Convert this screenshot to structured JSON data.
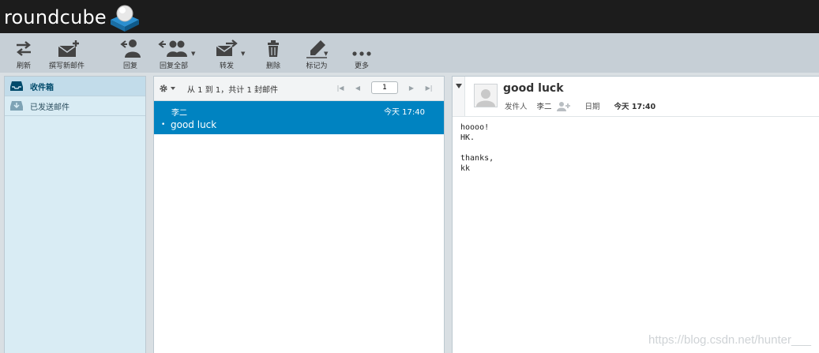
{
  "app": {
    "logo_text": "roundcube"
  },
  "toolbar": {
    "refresh": "刷新",
    "compose": "撰写新邮件",
    "reply": "回复",
    "reply_all": "回复全部",
    "forward": "转发",
    "delete": "删除",
    "mark": "标记为",
    "more": "更多"
  },
  "folders": [
    {
      "label": "收件箱",
      "icon": "inbox-icon",
      "selected": true
    },
    {
      "label": "已发送邮件",
      "icon": "sent-icon",
      "selected": false
    }
  ],
  "list": {
    "count_text": "从 1 到 1，共计 1 封邮件",
    "page": "1",
    "messages": [
      {
        "from": "李二",
        "date": "今天 17:40",
        "subject": "good luck",
        "unread_marker": "•"
      }
    ]
  },
  "preview": {
    "subject": "good luck",
    "from_label": "发件人",
    "from_name": "李二",
    "date_label": "日期",
    "date_value": "今天 17:40",
    "body": "hoooo!\nHK.\n\nthanks,\nkk"
  },
  "watermark": "https://blog.csdn.net/hunter___",
  "colors": {
    "accent": "#0083c1",
    "topbar": "#1c1c1c",
    "toolbar": "#c6cfd6",
    "folder_pane": "#d9ecf4"
  }
}
